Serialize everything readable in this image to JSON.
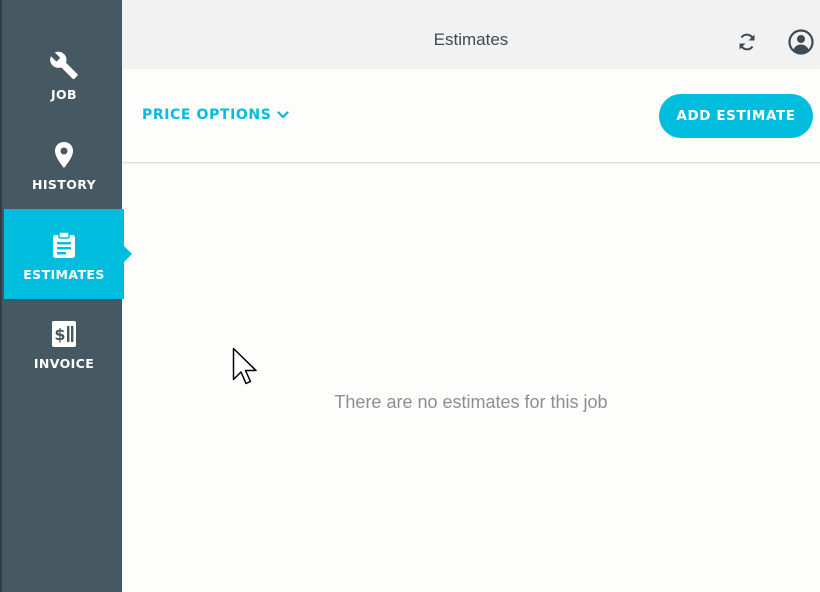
{
  "header": {
    "title": "Estimates"
  },
  "sidebar": {
    "items": [
      {
        "label": "JOB",
        "icon": "wrench-icon"
      },
      {
        "label": "HISTORY",
        "icon": "map-pin-icon"
      },
      {
        "label": "ESTIMATES",
        "icon": "clipboard-icon",
        "active": true
      },
      {
        "label": "INVOICE",
        "icon": "invoice-dollar-icon"
      }
    ]
  },
  "toolbar": {
    "price_options_label": "PRICE OPTIONS",
    "add_estimate_label": "ADD ESTIMATE"
  },
  "main": {
    "empty_message": "There are no estimates for this job"
  },
  "colors": {
    "accent": "#00bcdd",
    "sidebar_bg": "#465963",
    "topbar_bg": "#f2f2f2",
    "empty_text": "#8b8f92"
  }
}
